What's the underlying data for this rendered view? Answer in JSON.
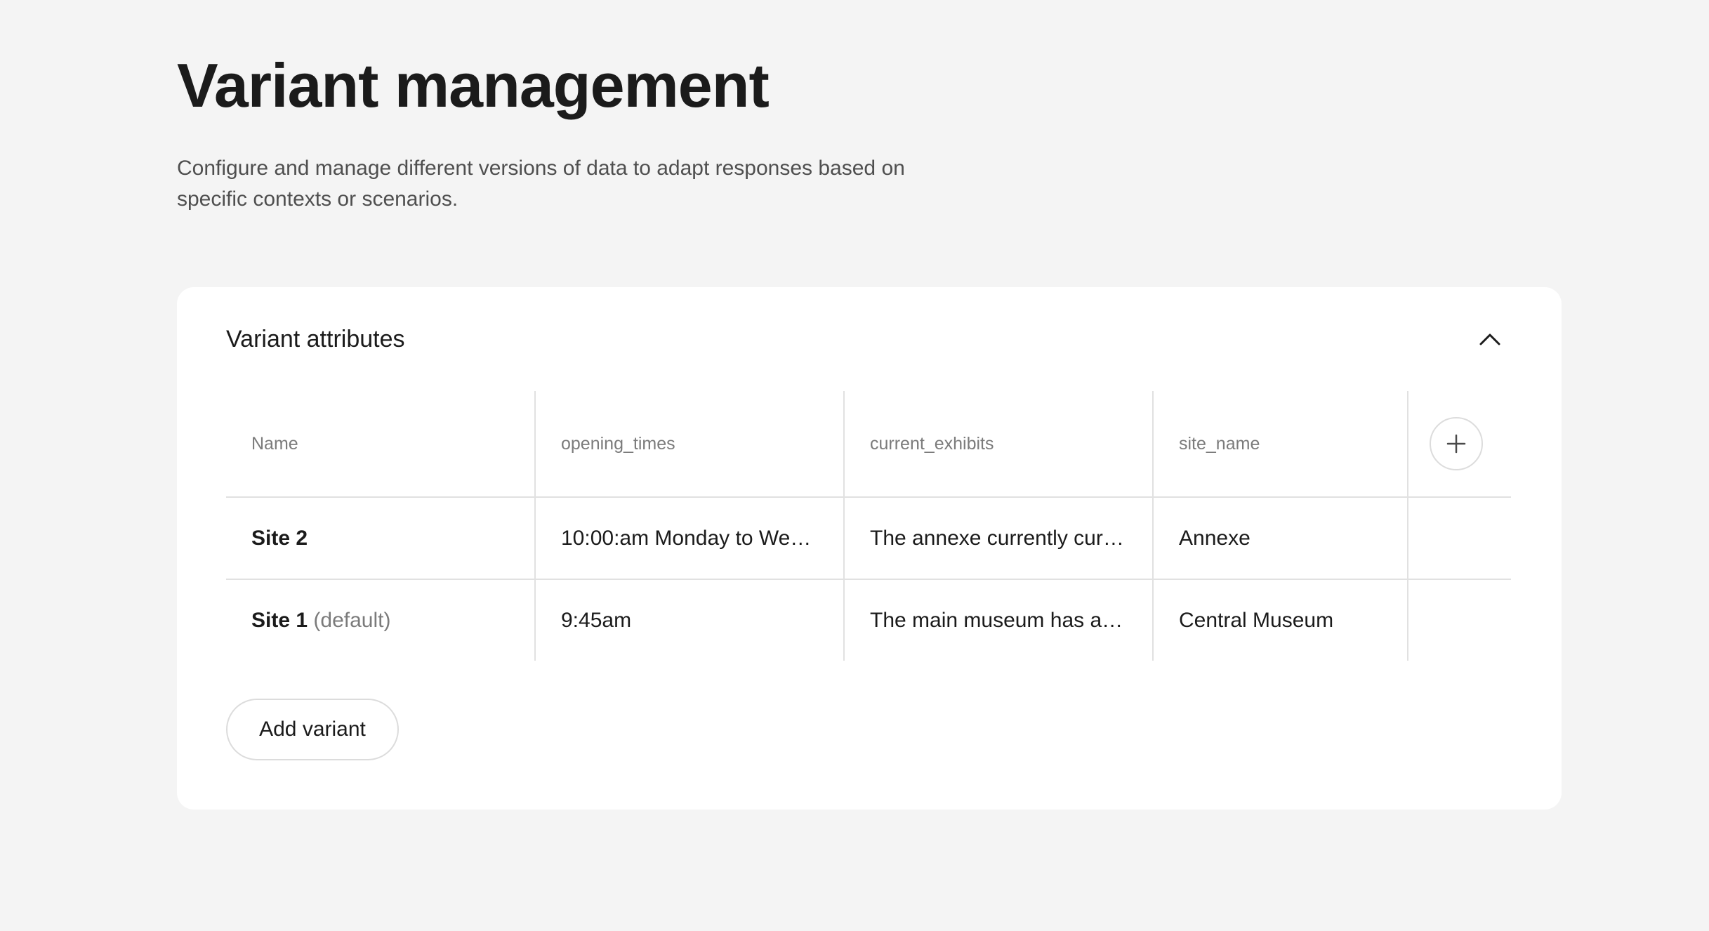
{
  "page": {
    "title": "Variant management",
    "description": "Configure and manage different versions of data to adapt responses based on specific contexts or scenarios."
  },
  "variant_attributes": {
    "title": "Variant attributes",
    "collapse_icon": "chevron-up-icon",
    "add_column_icon": "plus-icon",
    "columns": [
      "Name",
      "opening_times",
      "current_exhibits",
      "site_name"
    ],
    "rows": [
      {
        "name": "Site 2",
        "default_tag": "",
        "opening_times": "10:00:am Monday to Wed…",
        "current_exhibits": "The annexe currently curr…",
        "site_name": "Annexe"
      },
      {
        "name": "Site 1",
        "default_tag": "(default)",
        "opening_times": "9:45am",
        "current_exhibits": "The main museum has an…",
        "site_name": "Central Museum"
      }
    ],
    "add_variant_label": "Add variant"
  }
}
